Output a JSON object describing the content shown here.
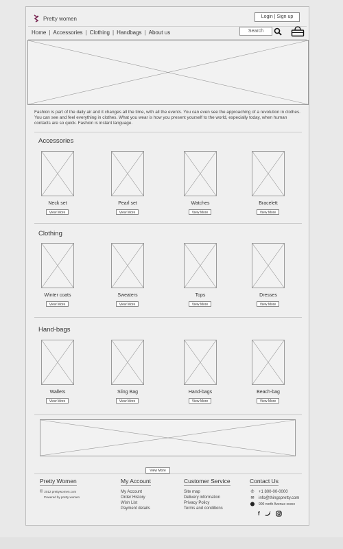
{
  "header": {
    "brand": "Pretty women",
    "login": "Login",
    "signup": "Sign up"
  },
  "nav": {
    "items": [
      "Home",
      "Accessories",
      "Clothing",
      "Handbags",
      "About us"
    ],
    "search_label": "Search"
  },
  "intro": "Fashion is part of the daily air and it changes all the time, with all the events. You can even see the approaching of a revolution in clothes. You can see and feel everything in clothes. What you wear is how you present yourself to the world, especially today, when human contacts are so quick. Fashion is instant language.",
  "sections": [
    {
      "title": "Accessories",
      "products": [
        "Neck set",
        "Pearl set",
        "Watches",
        "Bracelett"
      ]
    },
    {
      "title": "Clothing",
      "products": [
        "Winter coats",
        "Sweaters",
        "Tops",
        "Dresses"
      ]
    },
    {
      "title": "Hand-bags",
      "products": [
        "Wallets",
        "Sling Bag",
        "Hand-bags",
        "Beach-bag"
      ]
    }
  ],
  "view_more": "View More",
  "footer": {
    "brand_title": "Pretty Women",
    "copyright": "2012 prettywomen.com",
    "powered": "Powered by pretty women",
    "account_title": "My Account",
    "account_links": [
      "My Account",
      "Order History",
      "Wish List",
      "Payment details"
    ],
    "service_title": "Customer Service",
    "service_links": [
      "Site map",
      "Delivery information",
      "Privacy Policy",
      "Terms and conditions"
    ],
    "contact_title": "Contact Us",
    "phone": "+1 800-00-0000",
    "email": "info@thingspretty.com",
    "address": "900 north Avenue xxxxx"
  },
  "icons": [
    "logo-icon",
    "search-icon",
    "cart-icon",
    "copyright-icon",
    "phone-icon",
    "email-icon",
    "location-icon",
    "facebook-icon",
    "twitter-icon",
    "instagram-icon"
  ],
  "colors": {
    "logo": "#7a2a55",
    "background": "#e9e9e9",
    "panel": "#efefef"
  }
}
